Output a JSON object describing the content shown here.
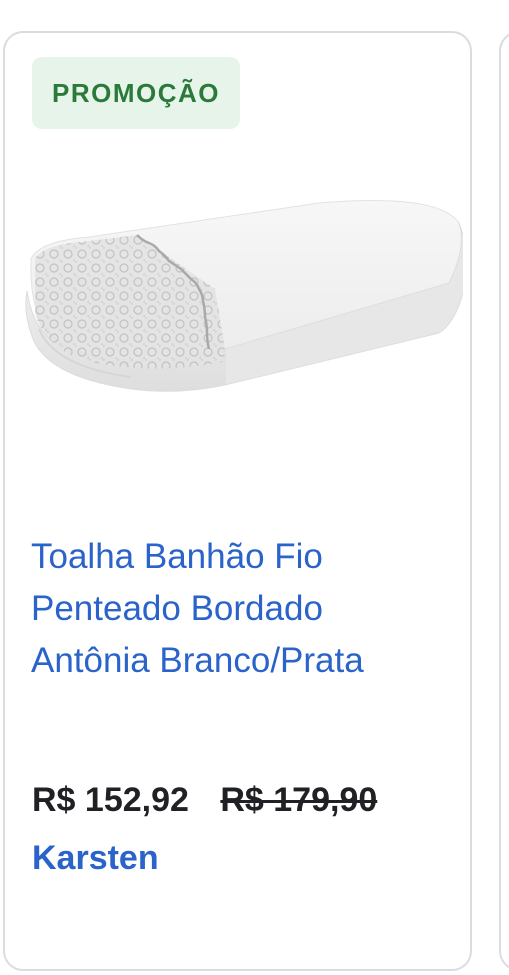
{
  "card": {
    "badge": "PROMOÇÃO",
    "image_alt": "towel-image",
    "title_lines": [
      "Toalha Banhão Fio",
      "Penteado Bordado",
      "Antônia Branco/Prata"
    ],
    "price": "R$ 152,92",
    "original_price": "R$ 179,90",
    "store": "Karsten"
  },
  "colors": {
    "badge_bg": "#e6f4ea",
    "badge_text": "#2b7a3a",
    "link": "#2a63c9",
    "text": "#202124",
    "border": "#dadce0"
  }
}
